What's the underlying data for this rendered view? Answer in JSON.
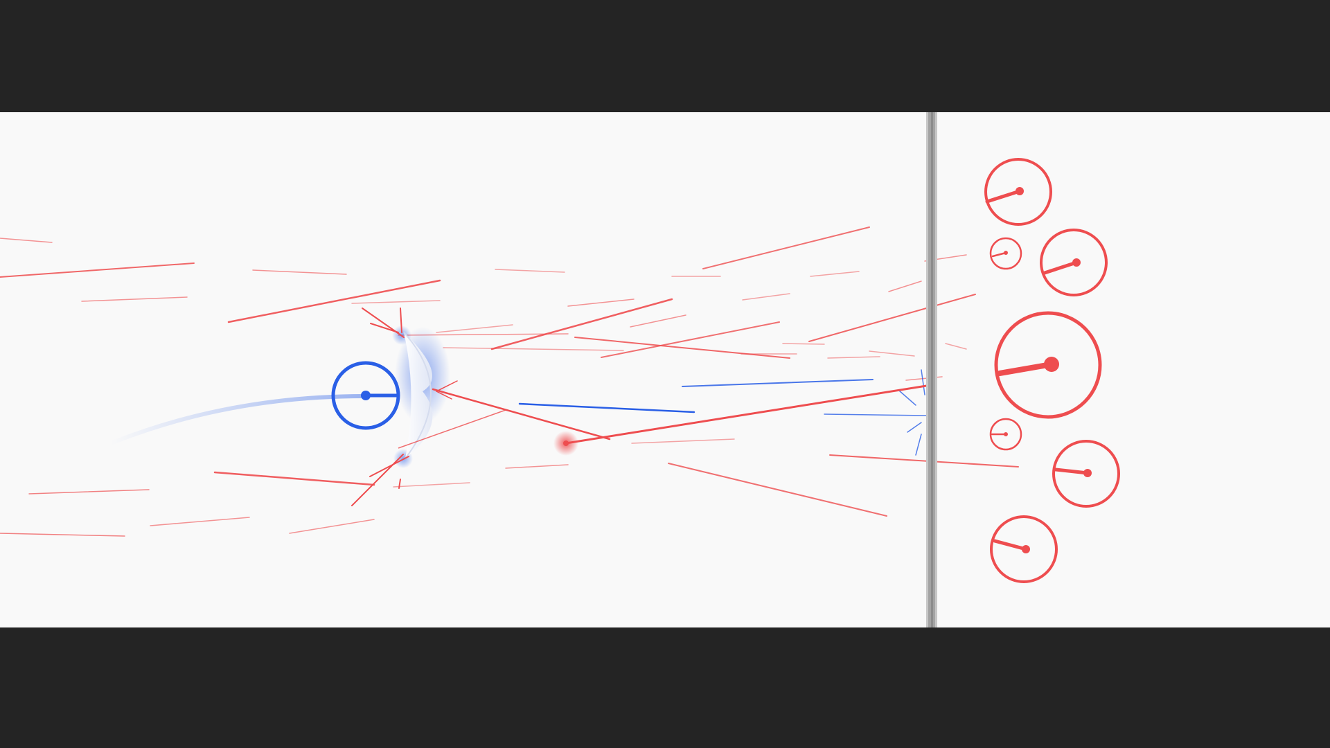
{
  "colors": {
    "letterbox": "#242424",
    "arena_background": "#f9f9f9",
    "player": "#2a5fe6",
    "enemy": "#ee4d4f",
    "divider": "#9e9e9e"
  },
  "player": {
    "icon": "circle-with-aim-line",
    "shield": "arc-deflector",
    "trail": "curved-motion-trail"
  },
  "enemies": {
    "count": 7,
    "icon": "circle-with-aim-line"
  },
  "projectiles": {
    "enemy_color": "red",
    "deflected_color": "blue"
  },
  "divider": {
    "type": "vertical-barrier"
  }
}
